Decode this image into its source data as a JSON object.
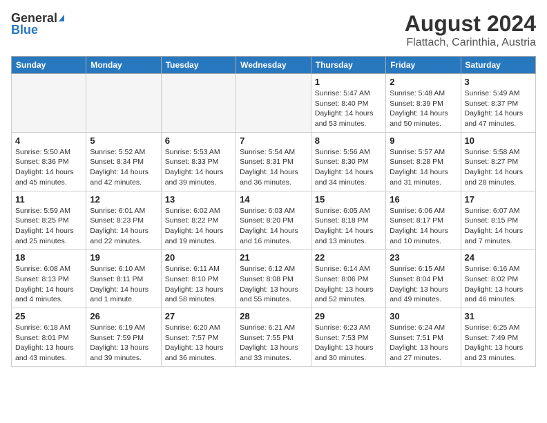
{
  "header": {
    "logo_general": "General",
    "logo_blue": "Blue",
    "month": "August 2024",
    "location": "Flattach, Carinthia, Austria"
  },
  "weekdays": [
    "Sunday",
    "Monday",
    "Tuesday",
    "Wednesday",
    "Thursday",
    "Friday",
    "Saturday"
  ],
  "weeks": [
    [
      {
        "day": "",
        "info": ""
      },
      {
        "day": "",
        "info": ""
      },
      {
        "day": "",
        "info": ""
      },
      {
        "day": "",
        "info": ""
      },
      {
        "day": "1",
        "info": "Sunrise: 5:47 AM\nSunset: 8:40 PM\nDaylight: 14 hours\nand 53 minutes."
      },
      {
        "day": "2",
        "info": "Sunrise: 5:48 AM\nSunset: 8:39 PM\nDaylight: 14 hours\nand 50 minutes."
      },
      {
        "day": "3",
        "info": "Sunrise: 5:49 AM\nSunset: 8:37 PM\nDaylight: 14 hours\nand 47 minutes."
      }
    ],
    [
      {
        "day": "4",
        "info": "Sunrise: 5:50 AM\nSunset: 8:36 PM\nDaylight: 14 hours\nand 45 minutes."
      },
      {
        "day": "5",
        "info": "Sunrise: 5:52 AM\nSunset: 8:34 PM\nDaylight: 14 hours\nand 42 minutes."
      },
      {
        "day": "6",
        "info": "Sunrise: 5:53 AM\nSunset: 8:33 PM\nDaylight: 14 hours\nand 39 minutes."
      },
      {
        "day": "7",
        "info": "Sunrise: 5:54 AM\nSunset: 8:31 PM\nDaylight: 14 hours\nand 36 minutes."
      },
      {
        "day": "8",
        "info": "Sunrise: 5:56 AM\nSunset: 8:30 PM\nDaylight: 14 hours\nand 34 minutes."
      },
      {
        "day": "9",
        "info": "Sunrise: 5:57 AM\nSunset: 8:28 PM\nDaylight: 14 hours\nand 31 minutes."
      },
      {
        "day": "10",
        "info": "Sunrise: 5:58 AM\nSunset: 8:27 PM\nDaylight: 14 hours\nand 28 minutes."
      }
    ],
    [
      {
        "day": "11",
        "info": "Sunrise: 5:59 AM\nSunset: 8:25 PM\nDaylight: 14 hours\nand 25 minutes."
      },
      {
        "day": "12",
        "info": "Sunrise: 6:01 AM\nSunset: 8:23 PM\nDaylight: 14 hours\nand 22 minutes."
      },
      {
        "day": "13",
        "info": "Sunrise: 6:02 AM\nSunset: 8:22 PM\nDaylight: 14 hours\nand 19 minutes."
      },
      {
        "day": "14",
        "info": "Sunrise: 6:03 AM\nSunset: 8:20 PM\nDaylight: 14 hours\nand 16 minutes."
      },
      {
        "day": "15",
        "info": "Sunrise: 6:05 AM\nSunset: 8:18 PM\nDaylight: 14 hours\nand 13 minutes."
      },
      {
        "day": "16",
        "info": "Sunrise: 6:06 AM\nSunset: 8:17 PM\nDaylight: 14 hours\nand 10 minutes."
      },
      {
        "day": "17",
        "info": "Sunrise: 6:07 AM\nSunset: 8:15 PM\nDaylight: 14 hours\nand 7 minutes."
      }
    ],
    [
      {
        "day": "18",
        "info": "Sunrise: 6:08 AM\nSunset: 8:13 PM\nDaylight: 14 hours\nand 4 minutes."
      },
      {
        "day": "19",
        "info": "Sunrise: 6:10 AM\nSunset: 8:11 PM\nDaylight: 14 hours\nand 1 minute."
      },
      {
        "day": "20",
        "info": "Sunrise: 6:11 AM\nSunset: 8:10 PM\nDaylight: 13 hours\nand 58 minutes."
      },
      {
        "day": "21",
        "info": "Sunrise: 6:12 AM\nSunset: 8:08 PM\nDaylight: 13 hours\nand 55 minutes."
      },
      {
        "day": "22",
        "info": "Sunrise: 6:14 AM\nSunset: 8:06 PM\nDaylight: 13 hours\nand 52 minutes."
      },
      {
        "day": "23",
        "info": "Sunrise: 6:15 AM\nSunset: 8:04 PM\nDaylight: 13 hours\nand 49 minutes."
      },
      {
        "day": "24",
        "info": "Sunrise: 6:16 AM\nSunset: 8:02 PM\nDaylight: 13 hours\nand 46 minutes."
      }
    ],
    [
      {
        "day": "25",
        "info": "Sunrise: 6:18 AM\nSunset: 8:01 PM\nDaylight: 13 hours\nand 43 minutes."
      },
      {
        "day": "26",
        "info": "Sunrise: 6:19 AM\nSunset: 7:59 PM\nDaylight: 13 hours\nand 39 minutes."
      },
      {
        "day": "27",
        "info": "Sunrise: 6:20 AM\nSunset: 7:57 PM\nDaylight: 13 hours\nand 36 minutes."
      },
      {
        "day": "28",
        "info": "Sunrise: 6:21 AM\nSunset: 7:55 PM\nDaylight: 13 hours\nand 33 minutes."
      },
      {
        "day": "29",
        "info": "Sunrise: 6:23 AM\nSunset: 7:53 PM\nDaylight: 13 hours\nand 30 minutes."
      },
      {
        "day": "30",
        "info": "Sunrise: 6:24 AM\nSunset: 7:51 PM\nDaylight: 13 hours\nand 27 minutes."
      },
      {
        "day": "31",
        "info": "Sunrise: 6:25 AM\nSunset: 7:49 PM\nDaylight: 13 hours\nand 23 minutes."
      }
    ]
  ]
}
